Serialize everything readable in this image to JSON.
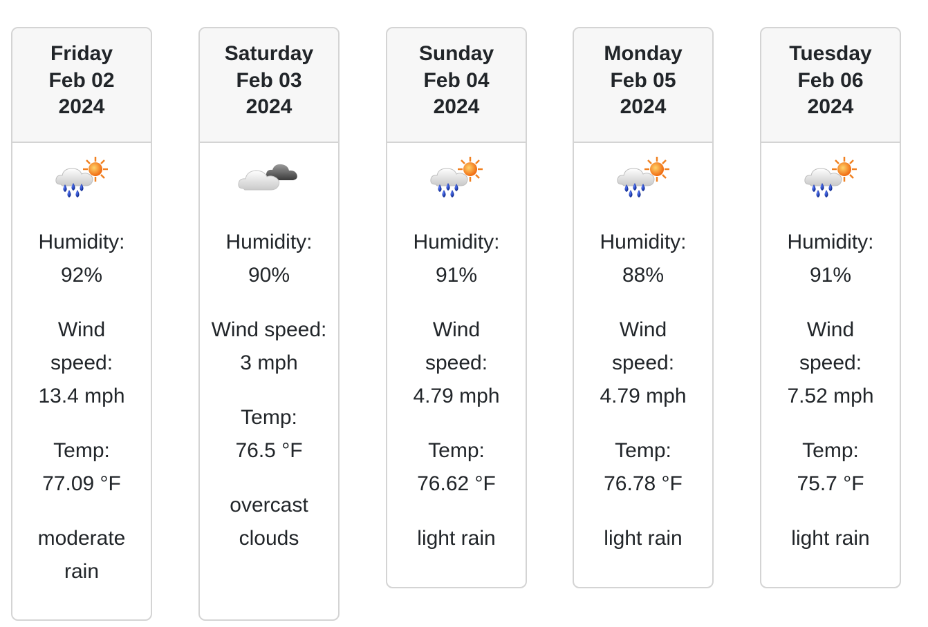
{
  "forecast": [
    {
      "day": "Friday",
      "date": "Feb 02",
      "year": "2024",
      "icon": "rain-sun-icon",
      "humidity_label": "Humidity:",
      "humidity": "92%",
      "wind_label": "Wind speed:",
      "wind": "13.4 mph",
      "temp_label": "Temp:",
      "temp": "77.09 °F",
      "description": "moderate rain"
    },
    {
      "day": "Saturday",
      "date": "Feb 03",
      "year": "2024",
      "icon": "overcast-clouds-icon",
      "humidity_label": "Humidity:",
      "humidity": "90%",
      "wind_label": "Wind speed:",
      "wind": "3 mph",
      "temp_label": "Temp:",
      "temp": "76.5 °F",
      "description": "overcast clouds"
    },
    {
      "day": "Sunday",
      "date": "Feb 04",
      "year": "2024",
      "icon": "rain-sun-icon",
      "humidity_label": "Humidity:",
      "humidity": "91%",
      "wind_label": "Wind speed:",
      "wind": "4.79 mph",
      "temp_label": "Temp:",
      "temp": "76.62 °F",
      "description": "light rain"
    },
    {
      "day": "Monday",
      "date": "Feb 05",
      "year": "2024",
      "icon": "rain-sun-icon",
      "humidity_label": "Humidity:",
      "humidity": "88%",
      "wind_label": "Wind speed:",
      "wind": "4.79 mph",
      "temp_label": "Temp:",
      "temp": "76.78 °F",
      "description": "light rain"
    },
    {
      "day": "Tuesday",
      "date": "Feb 06",
      "year": "2024",
      "icon": "rain-sun-icon",
      "humidity_label": "Humidity:",
      "humidity": "91%",
      "wind_label": "Wind speed:",
      "wind": "7.52 mph",
      "temp_label": "Temp:",
      "temp": "75.7 °F",
      "description": "light rain"
    }
  ],
  "colors": {
    "card_border": "#d4d4d4",
    "header_background": "#f7f7f7",
    "text": "#212529",
    "rain_drop": "#0a1f8f",
    "sun": "#f5a623"
  }
}
